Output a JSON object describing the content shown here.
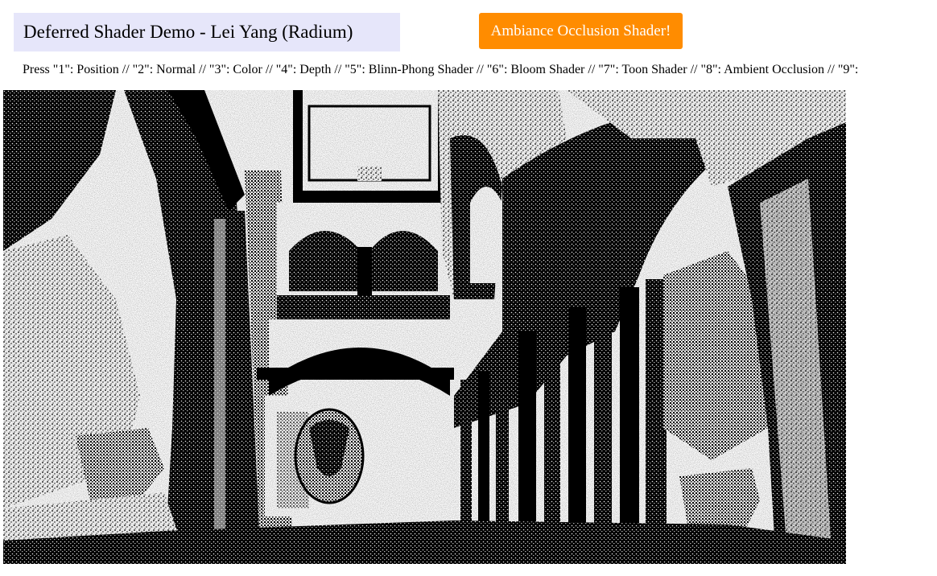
{
  "header": {
    "title": "Deferred Shader Demo - Lei Yang (Radium)",
    "shader_button_label": "Ambiance Occlusion Shader!"
  },
  "instructions": {
    "text": "Press \"1\": Position // \"2\": Normal // \"3\": Color // \"4\": Depth // \"5\": Blinn-Phong Shader // \"6\": Bloom Shader // \"7\": Toon Shader // \"8\": Ambient Occlusion // \"9\":"
  },
  "viewport": {
    "colors": {
      "ink": "#000000",
      "paper": "#ffffff"
    }
  }
}
